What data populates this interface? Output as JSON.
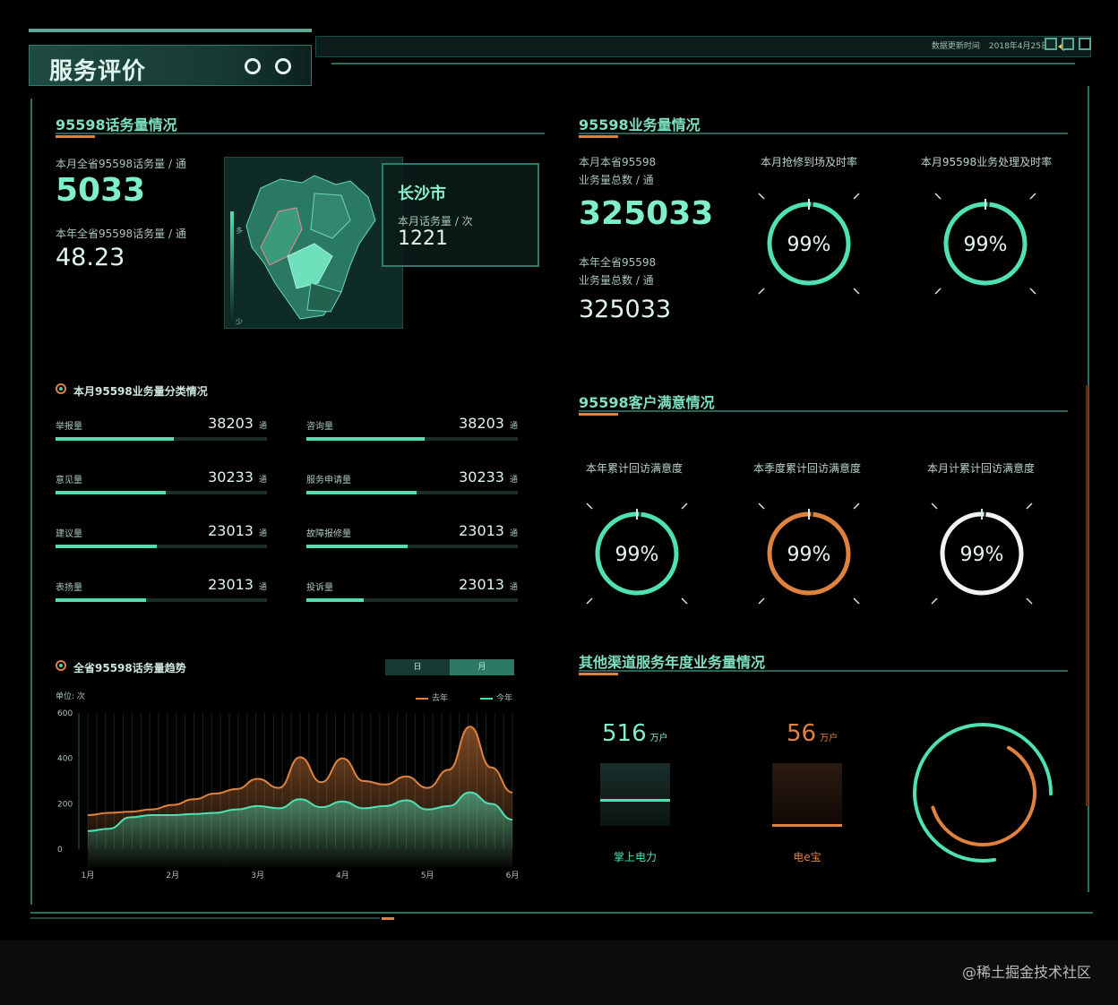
{
  "header": {
    "title": "服务评价",
    "update_label": "数据更新时间",
    "update_date": "2018年4月25日"
  },
  "calls": {
    "title": "95598话务量情况",
    "month_label": "本月全省95598话务量 / 通",
    "month_value": "5033",
    "year_label": "本年全省95598话务量 / 通",
    "year_value": "48.23",
    "map_axis_high": "多",
    "map_axis_low": "少",
    "city": {
      "name": "长沙市",
      "label": "本月话务量 / 次",
      "value": "1221"
    }
  },
  "business": {
    "title": "95598业务量情况",
    "month_label_1": "本月本省95598",
    "month_label_2": "业务量总数 / 通",
    "month_value": "325033",
    "year_label_1": "本年全省95598",
    "year_label_2": "业务量总数 / 通",
    "year_value": "325033",
    "gauges": [
      {
        "label": "本月抢修到场及时率",
        "value": "99%",
        "percent": 99,
        "color": "#4fe0b4"
      },
      {
        "label": "本月95598业务处理及时率",
        "value": "99%",
        "percent": 99,
        "color": "#4fe0b4"
      }
    ]
  },
  "classify": {
    "title": "本月95598业务量分类情况",
    "unit": "通",
    "items": [
      {
        "label": "举报量",
        "value": "38203",
        "percent": 56
      },
      {
        "label": "咨询量",
        "value": "38203",
        "percent": 56
      },
      {
        "label": "意见量",
        "value": "30233",
        "percent": 52
      },
      {
        "label": "服务申请量",
        "value": "30233",
        "percent": 52
      },
      {
        "label": "建议量",
        "value": "23013",
        "percent": 48
      },
      {
        "label": "故障报修量",
        "value": "23013",
        "percent": 48
      },
      {
        "label": "表扬量",
        "value": "23013",
        "percent": 43
      },
      {
        "label": "投诉量",
        "value": "23013",
        "percent": 27
      }
    ]
  },
  "satisfaction": {
    "title": "95598客户满意情况",
    "gauges": [
      {
        "label": "本年累计回访满意度",
        "value": "99%",
        "percent": 99,
        "color": "#4fe0b4"
      },
      {
        "label": "本季度累计回访满意度",
        "value": "99%",
        "percent": 99,
        "color": "#e0823f"
      },
      {
        "label": "本月计累计回访满意度",
        "value": "99%",
        "percent": 99,
        "color": "#f2f2f2"
      }
    ]
  },
  "trend": {
    "title": "全省95598话务量趋势",
    "toggle": [
      "日",
      "月"
    ],
    "unit_label": "单位: 次",
    "legend_last": "去年",
    "legend_this": "今年"
  },
  "channels": {
    "title": "其他渠道服务年度业务量情况",
    "items": [
      {
        "value": "516",
        "unit": "万户",
        "name": "掌上电力",
        "color": "#4fe0b4"
      },
      {
        "value": "56",
        "unit": "万户",
        "name": "电e宝",
        "color": "#e0823f"
      }
    ],
    "ring_values": [
      {
        "name": "掌上电力",
        "value": 516,
        "color": "#4fe0b4"
      },
      {
        "name": "电e宝",
        "value": 56,
        "color": "#e0823f"
      }
    ]
  },
  "chart_data": {
    "type": "area",
    "xlabel": "",
    "ylabel": "单位: 次",
    "ylim": [
      0,
      600
    ],
    "yticks": [
      0,
      200,
      400,
      600
    ],
    "x_ticks": [
      "1月",
      "2月",
      "3月",
      "4月",
      "5月",
      "6月"
    ],
    "x": [
      1,
      1.25,
      1.5,
      1.75,
      2,
      2.25,
      2.5,
      2.75,
      3,
      3.25,
      3.5,
      3.75,
      4,
      4.25,
      4.5,
      4.75,
      5,
      5.25,
      5.5,
      5.75,
      6
    ],
    "series": [
      {
        "name": "去年",
        "color": "#e0823f",
        "values": [
          150,
          160,
          165,
          175,
          195,
          220,
          245,
          265,
          310,
          270,
          405,
          295,
          400,
          300,
          285,
          320,
          270,
          350,
          540,
          360,
          250
        ]
      },
      {
        "name": "今年",
        "color": "#4fe0b4",
        "values": [
          80,
          90,
          140,
          150,
          150,
          155,
          160,
          175,
          190,
          180,
          220,
          185,
          210,
          180,
          190,
          215,
          175,
          190,
          250,
          200,
          130
        ]
      }
    ]
  },
  "watermark": "@稀土掘金技术社区"
}
